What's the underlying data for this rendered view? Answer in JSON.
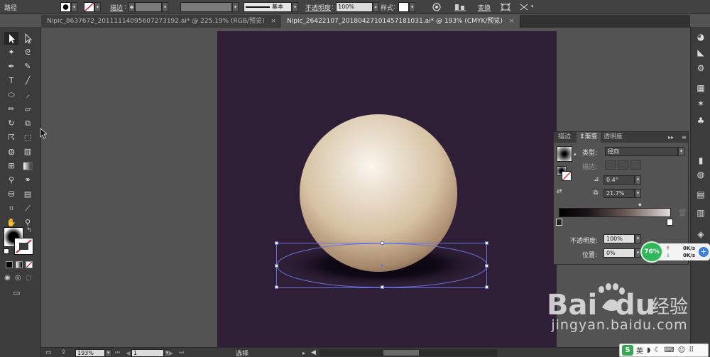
{
  "control_bar": {
    "selection_label": "路径",
    "stroke_label": "描边",
    "stroke_style": "基本",
    "opacity_label": "不透明度",
    "opacity_value": "100%",
    "style_label": "样式",
    "transform_label": "变换"
  },
  "doc_tabs": [
    {
      "title": "Nipic_8637672_20111114095607273192.ai* @ 225.19% (RGB/预览)",
      "active": false
    },
    {
      "title": "Nipic_26422107_20180427101457181031.ai* @ 193% (CMYK/预览)",
      "active": true
    }
  ],
  "tab_close_glyph": "×",
  "gradient_panel": {
    "tabs": [
      "描边",
      "渐变",
      "透明度"
    ],
    "type_label": "类型",
    "type_value": "径向",
    "stroke_label": "描边",
    "angle_value": "0.4°",
    "ratio_value": "21.7%",
    "opacity_label": "不透明度",
    "opacity_value": "100%",
    "location_label": "位置",
    "location_value": "0%"
  },
  "network_widget": {
    "percent": "76%",
    "up_speed": "0K/s",
    "down_speed": "0K/s"
  },
  "status_bar": {
    "zoom_value": "193%",
    "artboard_value": "1",
    "status_text": "选择"
  },
  "watermark": {
    "text": "jingyan.baidu.com"
  },
  "ime": {
    "mode": "英"
  },
  "colors": {
    "artboard_bg": "#2e1f36",
    "sphere_highlight": "#fbf6ee",
    "sphere_mid": "#d7c2a3",
    "sphere_edge": "#7e6450",
    "selection_blue": "#6a71d8",
    "link_orange": "#e98d2e"
  },
  "icons": {
    "toolbox": [
      "selection-tool-icon",
      "direct-selection-tool-icon",
      "magic-wand-icon",
      "lasso-icon",
      "pen-tool-icon",
      "curvature-icon",
      "type-tool-icon",
      "line-tool-icon",
      "ellipse-tool-icon",
      "paintbrush-icon",
      "pencil-icon",
      "eraser-icon",
      "rotate-icon",
      "scale-icon",
      "warp-icon",
      "free-transform-icon",
      "shape-builder-icon",
      "perspective-icon",
      "mesh-icon",
      "gradient-tool-icon",
      "eyedropper-icon",
      "blend-icon",
      "symbol-sprayer-icon",
      "graph-icon",
      "artboard-tool-icon",
      "slice-icon",
      "hand-tool-icon",
      "zoom-tool-icon"
    ]
  }
}
